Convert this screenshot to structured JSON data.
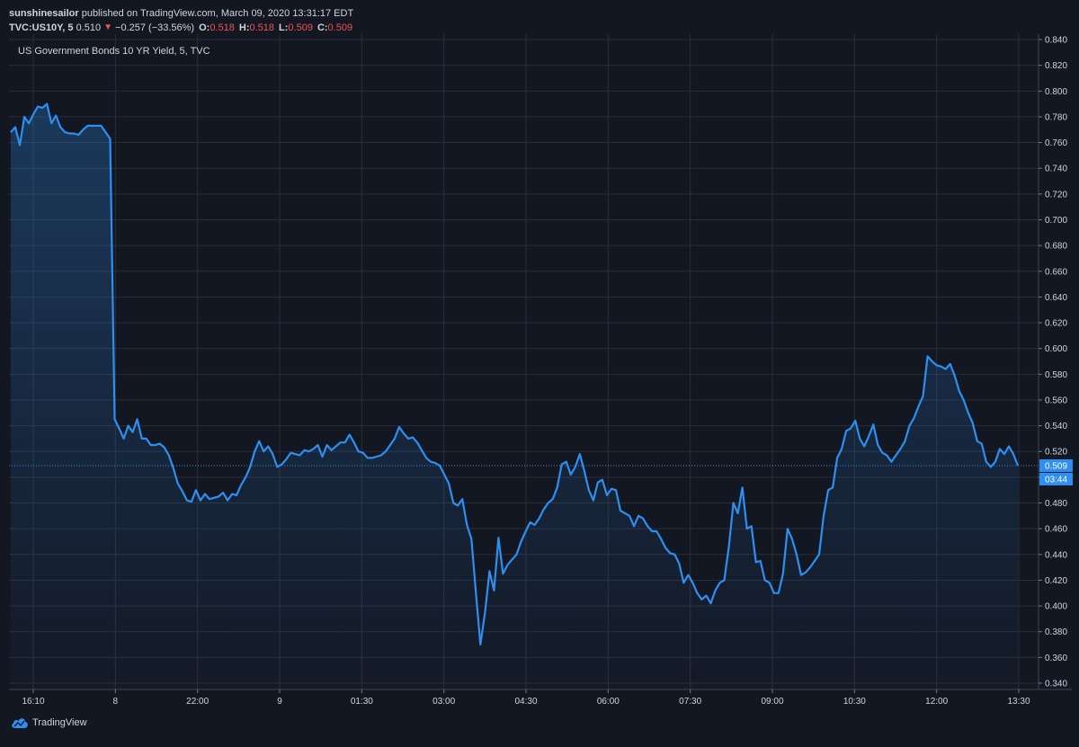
{
  "header": {
    "user": "sunshinesailor",
    "published_text": "published on TradingView.com, March 09, 2020 13:31:17 EDT",
    "symbol": "TVC:US10Y, 5",
    "last": "0.510",
    "change": "−0.257 (−33.56%)",
    "o_label": "O:",
    "o_value": "0.518",
    "h_label": "H:",
    "h_value": "0.518",
    "l_label": "L:",
    "l_value": "0.509",
    "c_label": "C:",
    "c_value": "0.509"
  },
  "pane_title": "US Government Bonds 10 YR Yield, 5, TVC",
  "footer": {
    "brand": "TradingView"
  },
  "colors": {
    "background": "#131722",
    "grid": "#2a2e39",
    "line": "#2e8ff0",
    "negative": "#ef5350",
    "text": "#d1d4dc",
    "badge": "#2e8ff0"
  },
  "icons": {
    "change_arrow": "triangle-down-icon",
    "brand_logo": "tradingview-cloud-icon"
  },
  "chart_data": {
    "type": "area",
    "title": "US Government Bonds 10 YR Yield, 5, TVC",
    "ylim": [
      0.34,
      0.84
    ],
    "y_ticks": [
      "0.340",
      "0.360",
      "0.380",
      "0.400",
      "0.420",
      "0.440",
      "0.460",
      "0.480",
      "0.500",
      "0.520",
      "0.540",
      "0.560",
      "0.580",
      "0.600",
      "0.620",
      "0.640",
      "0.660",
      "0.680",
      "0.700",
      "0.720",
      "0.740",
      "0.760",
      "0.780",
      "0.800",
      "0.820",
      "0.840"
    ],
    "x_ticks": [
      "16:10",
      "8",
      "22:00",
      "9",
      "01:30",
      "03:00",
      "04:30",
      "06:00",
      "07:30",
      "09:00",
      "10:30",
      "12:00",
      "13:30"
    ],
    "grid": true,
    "current_value": {
      "value": 0.509,
      "label": "0.509",
      "time_label": "03:44"
    },
    "series": [
      {
        "values": [
          0.768,
          0.772,
          0.758,
          0.78,
          0.775,
          0.782,
          0.788,
          0.787,
          0.79,
          0.775,
          0.781,
          0.772,
          0.768,
          0.767,
          0.767,
          0.766,
          0.77,
          0.773,
          0.773,
          0.773,
          0.773,
          0.768,
          0.763,
          0.545,
          0.538,
          0.53,
          0.54,
          0.535,
          0.545,
          0.53,
          0.53,
          0.525,
          0.525,
          0.526,
          0.523,
          0.517,
          0.507,
          0.495,
          0.489,
          0.482,
          0.481,
          0.49,
          0.482,
          0.487,
          0.483,
          0.484,
          0.485,
          0.488,
          0.482,
          0.487,
          0.486,
          0.494,
          0.5,
          0.508,
          0.52,
          0.528,
          0.52,
          0.524,
          0.518,
          0.508,
          0.51,
          0.514,
          0.519,
          0.518,
          0.517,
          0.521,
          0.52,
          0.522,
          0.525,
          0.516,
          0.525,
          0.521,
          0.524,
          0.527,
          0.527,
          0.533,
          0.527,
          0.52,
          0.519,
          0.515,
          0.515,
          0.516,
          0.517,
          0.52,
          0.525,
          0.53,
          0.539,
          0.534,
          0.53,
          0.531,
          0.527,
          0.521,
          0.515,
          0.512,
          0.511,
          0.509,
          0.502,
          0.495,
          0.48,
          0.478,
          0.483,
          0.463,
          0.452,
          0.41,
          0.37,
          0.395,
          0.427,
          0.412,
          0.453,
          0.425,
          0.432,
          0.436,
          0.44,
          0.45,
          0.458,
          0.465,
          0.463,
          0.468,
          0.475,
          0.48,
          0.483,
          0.492,
          0.51,
          0.512,
          0.502,
          0.508,
          0.518,
          0.505,
          0.49,
          0.482,
          0.496,
          0.498,
          0.486,
          0.491,
          0.49,
          0.474,
          0.472,
          0.47,
          0.462,
          0.47,
          0.468,
          0.462,
          0.458,
          0.458,
          0.452,
          0.445,
          0.441,
          0.44,
          0.433,
          0.418,
          0.424,
          0.418,
          0.41,
          0.405,
          0.408,
          0.402,
          0.412,
          0.418,
          0.42,
          0.446,
          0.48,
          0.472,
          0.492,
          0.46,
          0.462,
          0.434,
          0.435,
          0.42,
          0.418,
          0.41,
          0.41,
          0.425,
          0.46,
          0.452,
          0.44,
          0.424,
          0.426,
          0.43,
          0.435,
          0.44,
          0.47,
          0.49,
          0.492,
          0.515,
          0.522,
          0.536,
          0.538,
          0.544,
          0.53,
          0.524,
          0.532,
          0.541,
          0.525,
          0.519,
          0.517,
          0.512,
          0.517,
          0.522,
          0.528,
          0.54,
          0.546,
          0.555,
          0.563,
          0.594,
          0.59,
          0.587,
          0.586,
          0.584,
          0.588,
          0.579,
          0.567,
          0.56,
          0.55,
          0.542,
          0.528,
          0.526,
          0.512,
          0.508,
          0.512,
          0.522,
          0.518,
          0.524,
          0.518,
          0.509
        ]
      }
    ]
  }
}
